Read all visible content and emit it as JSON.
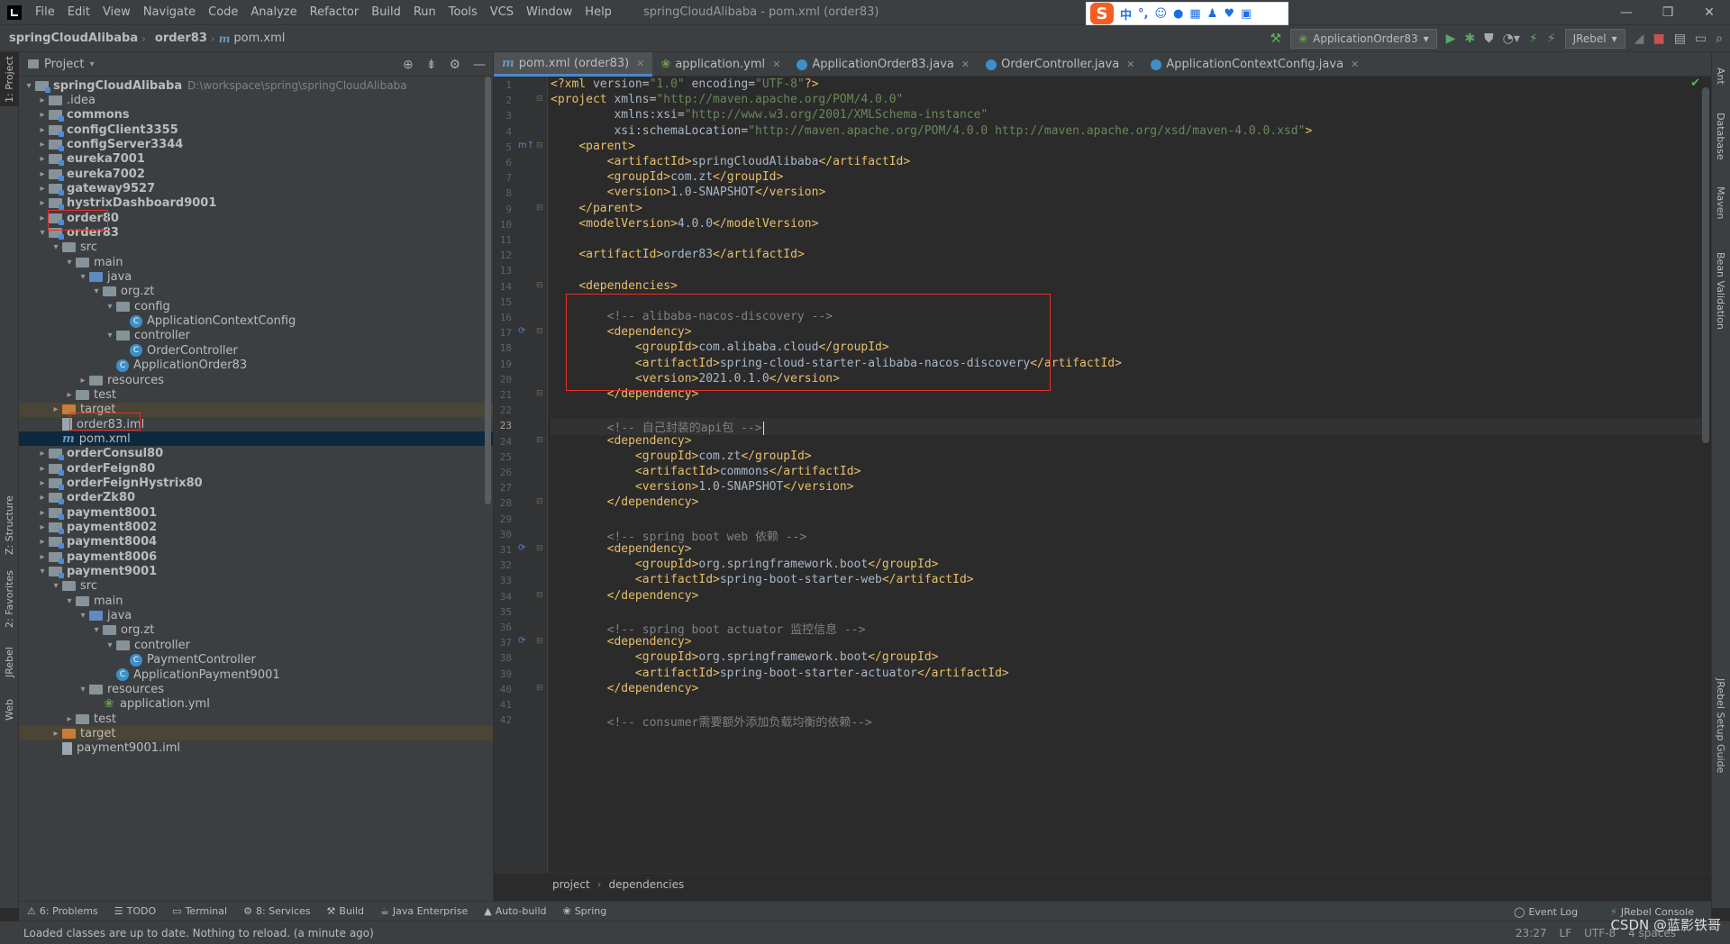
{
  "menubar": {
    "items": [
      "File",
      "Edit",
      "View",
      "Navigate",
      "Code",
      "Analyze",
      "Refactor",
      "Build",
      "Run",
      "Tools",
      "VCS",
      "Window",
      "Help"
    ],
    "window_title": "springCloudAlibaba - pom.xml (order83)"
  },
  "navbar": {
    "project": "springCloudAlibaba",
    "module": "order83",
    "file": "pom.xml",
    "run_config": "ApplicationOrder83",
    "jrebel": "JRebel"
  },
  "project_panel": {
    "title": "Project",
    "tree": [
      {
        "label": "springCloudAlibaba",
        "hint": "D:\\workspace\\spring\\springCloudAlibaba",
        "kind": "module",
        "depth": 0,
        "arrow": "▾",
        "bold": true
      },
      {
        "label": ".idea",
        "kind": "folder",
        "depth": 1,
        "arrow": "▸"
      },
      {
        "label": "commons",
        "kind": "module",
        "depth": 1,
        "arrow": "▸",
        "bold": true
      },
      {
        "label": "configClient3355",
        "kind": "module",
        "depth": 1,
        "arrow": "▸",
        "bold": true
      },
      {
        "label": "configServer3344",
        "kind": "module",
        "depth": 1,
        "arrow": "▸",
        "bold": true
      },
      {
        "label": "eureka7001",
        "kind": "module",
        "depth": 1,
        "arrow": "▸",
        "bold": true
      },
      {
        "label": "eureka7002",
        "kind": "module",
        "depth": 1,
        "arrow": "▸",
        "bold": true
      },
      {
        "label": "gateway9527",
        "kind": "module",
        "depth": 1,
        "arrow": "▸",
        "bold": true
      },
      {
        "label": "hystrixDashboard9001",
        "kind": "module",
        "depth": 1,
        "arrow": "▸",
        "bold": true
      },
      {
        "label": "order80",
        "kind": "module",
        "depth": 1,
        "arrow": "▸",
        "bold": true
      },
      {
        "label": "order83",
        "kind": "module",
        "depth": 1,
        "arrow": "▾",
        "bold": true
      },
      {
        "label": "src",
        "kind": "folder",
        "depth": 2,
        "arrow": "▾"
      },
      {
        "label": "main",
        "kind": "folder",
        "depth": 3,
        "arrow": "▾"
      },
      {
        "label": "java",
        "kind": "blue",
        "depth": 4,
        "arrow": "▾"
      },
      {
        "label": "org.zt",
        "kind": "folder",
        "depth": 5,
        "arrow": "▾"
      },
      {
        "label": "config",
        "kind": "folder",
        "depth": 6,
        "arrow": "▾"
      },
      {
        "label": "ApplicationContextConfig",
        "kind": "class",
        "depth": 7,
        "arrow": ""
      },
      {
        "label": "controller",
        "kind": "folder",
        "depth": 6,
        "arrow": "▾"
      },
      {
        "label": "OrderController",
        "kind": "class",
        "depth": 7,
        "arrow": ""
      },
      {
        "label": "ApplicationOrder83",
        "kind": "class",
        "depth": 6,
        "arrow": ""
      },
      {
        "label": "resources",
        "kind": "folder",
        "depth": 4,
        "arrow": "▸"
      },
      {
        "label": "test",
        "kind": "folder",
        "depth": 3,
        "arrow": "▸"
      },
      {
        "label": "target",
        "kind": "orange",
        "depth": 2,
        "arrow": "▸",
        "highlight": "target"
      },
      {
        "label": "order83.iml",
        "kind": "iml",
        "depth": 2,
        "arrow": ""
      },
      {
        "label": "pom.xml",
        "kind": "maven",
        "depth": 2,
        "arrow": "",
        "highlight": "selected"
      },
      {
        "label": "orderConsul80",
        "kind": "module",
        "depth": 1,
        "arrow": "▸",
        "bold": true
      },
      {
        "label": "orderFeign80",
        "kind": "module",
        "depth": 1,
        "arrow": "▸",
        "bold": true
      },
      {
        "label": "orderFeignHystrix80",
        "kind": "module",
        "depth": 1,
        "arrow": "▸",
        "bold": true
      },
      {
        "label": "orderZk80",
        "kind": "module",
        "depth": 1,
        "arrow": "▸",
        "bold": true
      },
      {
        "label": "payment8001",
        "kind": "module",
        "depth": 1,
        "arrow": "▸",
        "bold": true
      },
      {
        "label": "payment8002",
        "kind": "module",
        "depth": 1,
        "arrow": "▸",
        "bold": true
      },
      {
        "label": "payment8004",
        "kind": "module",
        "depth": 1,
        "arrow": "▸",
        "bold": true
      },
      {
        "label": "payment8006",
        "kind": "module",
        "depth": 1,
        "arrow": "▸",
        "bold": true
      },
      {
        "label": "payment9001",
        "kind": "module",
        "depth": 1,
        "arrow": "▾",
        "bold": true
      },
      {
        "label": "src",
        "kind": "folder",
        "depth": 2,
        "arrow": "▾"
      },
      {
        "label": "main",
        "kind": "folder",
        "depth": 3,
        "arrow": "▾"
      },
      {
        "label": "java",
        "kind": "blue",
        "depth": 4,
        "arrow": "▾"
      },
      {
        "label": "org.zt",
        "kind": "folder",
        "depth": 5,
        "arrow": "▾"
      },
      {
        "label": "controller",
        "kind": "folder",
        "depth": 6,
        "arrow": "▾"
      },
      {
        "label": "PaymentController",
        "kind": "class",
        "depth": 7,
        "arrow": ""
      },
      {
        "label": "ApplicationPayment9001",
        "kind": "class",
        "depth": 6,
        "arrow": ""
      },
      {
        "label": "resources",
        "kind": "folder",
        "depth": 4,
        "arrow": "▾"
      },
      {
        "label": "application.yml",
        "kind": "yml",
        "depth": 5,
        "arrow": ""
      },
      {
        "label": "test",
        "kind": "folder",
        "depth": 3,
        "arrow": "▸"
      },
      {
        "label": "target",
        "kind": "orange",
        "depth": 2,
        "arrow": "▸",
        "highlight": "target"
      },
      {
        "label": "payment9001.iml",
        "kind": "iml",
        "depth": 2,
        "arrow": ""
      }
    ]
  },
  "editor_tabs": [
    {
      "label": "pom.xml (order83)",
      "icon": "maven-icon",
      "active": true
    },
    {
      "label": "application.yml",
      "icon": "yml-icon",
      "active": false
    },
    {
      "label": "ApplicationOrder83.java",
      "icon": "class-icon",
      "active": false
    },
    {
      "label": "OrderController.java",
      "icon": "class-icon",
      "active": false
    },
    {
      "label": "ApplicationContextConfig.java",
      "icon": "class-icon",
      "active": false
    }
  ],
  "code_lines": [
    "<?xml version=\"1.0\" encoding=\"UTF-8\"?>",
    "<project xmlns=\"http://maven.apache.org/POM/4.0.0\"",
    "         xmlns:xsi=\"http://www.w3.org/2001/XMLSchema-instance\"",
    "         xsi:schemaLocation=\"http://maven.apache.org/POM/4.0.0 http://maven.apache.org/xsd/maven-4.0.0.xsd\">",
    "    <parent>",
    "        <artifactId>springCloudAlibaba</artifactId>",
    "        <groupId>com.zt</groupId>",
    "        <version>1.0-SNAPSHOT</version>",
    "    </parent>",
    "    <modelVersion>4.0.0</modelVersion>",
    "",
    "    <artifactId>order83</artifactId>",
    "",
    "    <dependencies>",
    "",
    "        <!-- alibaba-nacos-discovery -->",
    "        <dependency>",
    "            <groupId>com.alibaba.cloud</groupId>",
    "            <artifactId>spring-cloud-starter-alibaba-nacos-discovery</artifactId>",
    "            <version>2021.0.1.0</version>",
    "        </dependency>",
    "",
    "        <!-- 自己封装的api包 -->",
    "        <dependency>",
    "            <groupId>com.zt</groupId>",
    "            <artifactId>commons</artifactId>",
    "            <version>1.0-SNAPSHOT</version>",
    "        </dependency>",
    "",
    "        <!-- spring boot web 依赖 -->",
    "        <dependency>",
    "            <groupId>org.springframework.boot</groupId>",
    "            <artifactId>spring-boot-starter-web</artifactId>",
    "        </dependency>",
    "",
    "        <!-- spring boot actuator 监控信息 -->",
    "        <dependency>",
    "            <groupId>org.springframework.boot</groupId>",
    "            <artifactId>spring-boot-starter-actuator</artifactId>",
    "        </dependency>",
    "",
    "        <!-- consumer需要额外添加负载均衡的依赖-->"
  ],
  "current_line": 23,
  "editor_breadcrumb": [
    "project",
    "dependencies"
  ],
  "bottom_tools": [
    {
      "label": "6: Problems",
      "icon": "problems-icon"
    },
    {
      "label": "TODO",
      "icon": "todo-icon"
    },
    {
      "label": "Terminal",
      "icon": "terminal-icon"
    },
    {
      "label": "8: Services",
      "icon": "services-icon"
    },
    {
      "label": "Build",
      "icon": "build-icon"
    },
    {
      "label": "Java Enterprise",
      "icon": "java-enterprise-icon"
    },
    {
      "label": "Auto-build",
      "icon": "auto-build-icon"
    },
    {
      "label": "Spring",
      "icon": "spring-icon"
    }
  ],
  "bottom_right": {
    "event_log": "Event Log",
    "jrebel_console": "JRebel Console"
  },
  "status": {
    "message": "Loaded classes are up to date. Nothing to reload. (a minute ago)",
    "position": "23:27",
    "line_sep": "LF",
    "encoding": "UTF-8",
    "indent": "4 spaces"
  },
  "left_stripe": [
    "1: Project",
    "Z: Structure",
    "2: Favorites",
    "JRebel",
    "Web"
  ],
  "right_stripe": [
    "Ant",
    "Database",
    "Maven",
    "Bean Validation",
    "JRebel Setup Guide"
  ],
  "watermark": "CSDN @蓝影铁哥"
}
